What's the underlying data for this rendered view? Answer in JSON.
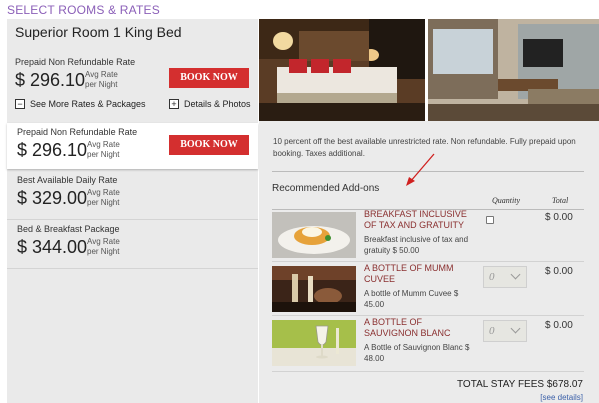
{
  "header": {
    "title": "SELECT ROOMS & RATES"
  },
  "room": {
    "title": "Superior Room 1 King Bed",
    "first_rate": {
      "name": "Prepaid Non Refundable Rate",
      "price": "$ 296.10",
      "avg_line1": "Avg Rate",
      "avg_line2": "per Night",
      "button": "BOOK NOW"
    },
    "see_more": "See More Rates & Packages",
    "details": "Details & Photos"
  },
  "rates": [
    {
      "name": "Prepaid Non Refundable Rate",
      "price": "$ 296.10",
      "avg_line1": "Avg Rate",
      "avg_line2": "per Night",
      "button": "BOOK NOW"
    },
    {
      "name": "Best Available Daily Rate",
      "price": "$ 329.00",
      "avg_line1": "Avg Rate",
      "avg_line2": "per Night"
    },
    {
      "name": "Bed & Breakfast Package",
      "price": "$ 344.00",
      "avg_line1": "Avg Rate",
      "avg_line2": "per Night"
    }
  ],
  "detail": {
    "description": "10 percent off the best available unrestricted rate. Non refundable. Fully prepaid upon booking. Taxes additional.",
    "addons_title": "Recommended Add-ons",
    "col_quantity": "Quantity",
    "col_total": "Total",
    "addons": [
      {
        "name": "BREAKFAST INCLUSIVE OF TAX AND GRATUITY",
        "desc": "Breakfast inclusive of tax and gratuity $ 50.00",
        "total": "$ 0.00"
      },
      {
        "name": "A BOTTLE OF MUMM CUVEE",
        "desc": "A bottle of Mumm Cuvee $ 45.00",
        "qty": "0",
        "total": "$ 0.00"
      },
      {
        "name": "A BOTTLE OF SAUVIGNON BLANC",
        "desc": "A Bottle of Sauvignon Blanc $ 48.00",
        "qty": "0",
        "total": "$ 0.00"
      }
    ],
    "stay_total": "TOTAL STAY FEES $678.07",
    "see_details": "[see details]"
  },
  "colors": {
    "accent_purple": "#8b5fb8",
    "book_red": "#d42f2f",
    "addon_title": "#8a2f2f",
    "arrow_red": "#d0201f"
  },
  "icons": [
    "minus-box-icon",
    "plus-box-icon",
    "chevron-down-icon",
    "checkbox-icon"
  ]
}
